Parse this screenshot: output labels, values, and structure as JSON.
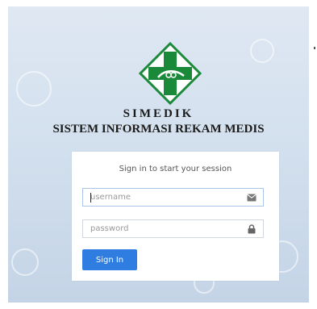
{
  "brand": {
    "title": "SIMEDIK",
    "subtitle": "SISTEM INFORMASI REKAM MEDIS",
    "logo_icon": "medical-cross-logo-icon",
    "logo_color": "#1a8a3a"
  },
  "login": {
    "message": "Sign in to start your session",
    "username": {
      "placeholder": "username",
      "value": "",
      "icon": "envelope-icon"
    },
    "password": {
      "placeholder": "password",
      "value": "",
      "icon": "lock-icon"
    },
    "submit_label": "Sign In",
    "accent_color": "#2f7de1"
  }
}
